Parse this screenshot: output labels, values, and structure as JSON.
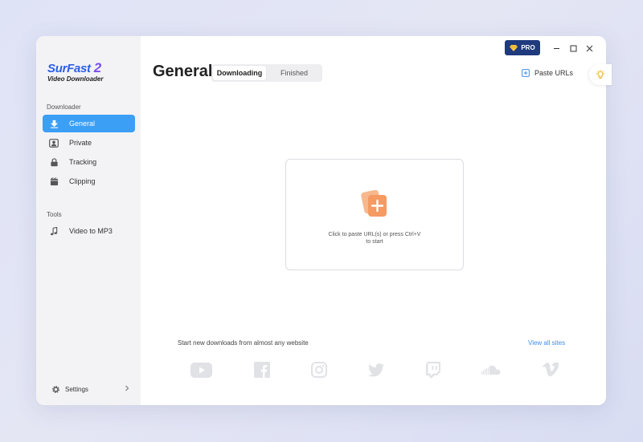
{
  "app": {
    "logo_title": "SurFast",
    "logo_version": "2",
    "logo_subtitle": "Video Downloader"
  },
  "sidebar": {
    "downloader_label": "Downloader",
    "items": [
      {
        "label": "General",
        "icon": "download-arrow-icon",
        "active": true
      },
      {
        "label": "Private",
        "icon": "private-icon",
        "active": false
      },
      {
        "label": "Tracking",
        "icon": "lock-icon",
        "active": false
      },
      {
        "label": "Clipping",
        "icon": "film-clip-icon",
        "active": false
      }
    ],
    "tools_label": "Tools",
    "tools": [
      {
        "label": "Video to MP3",
        "icon": "music-note-icon"
      }
    ],
    "settings_label": "Settings"
  },
  "header": {
    "title": "General",
    "tabs": [
      {
        "label": "Downloading",
        "active": true
      },
      {
        "label": "Finished",
        "active": false
      }
    ],
    "pro_label": "PRO",
    "paste_urls_label": "Paste URLs"
  },
  "drop_zone": {
    "line1": "Click to paste URL(s) or press Ctrl+V",
    "line2": "to start"
  },
  "footer": {
    "start_text": "Start new downloads from almost any website",
    "view_all_label": "View all sites",
    "sites": [
      "youtube-icon",
      "facebook-icon",
      "instagram-icon",
      "twitter-icon",
      "twitch-icon",
      "soundcloud-icon",
      "vimeo-icon"
    ]
  },
  "colors": {
    "accent": "#3b9ff6",
    "pro_bg": "#1f3a7d",
    "link": "#3b8ef0",
    "logo_blue": "#2e5ee8",
    "logo_purple": "#7b4df0"
  }
}
